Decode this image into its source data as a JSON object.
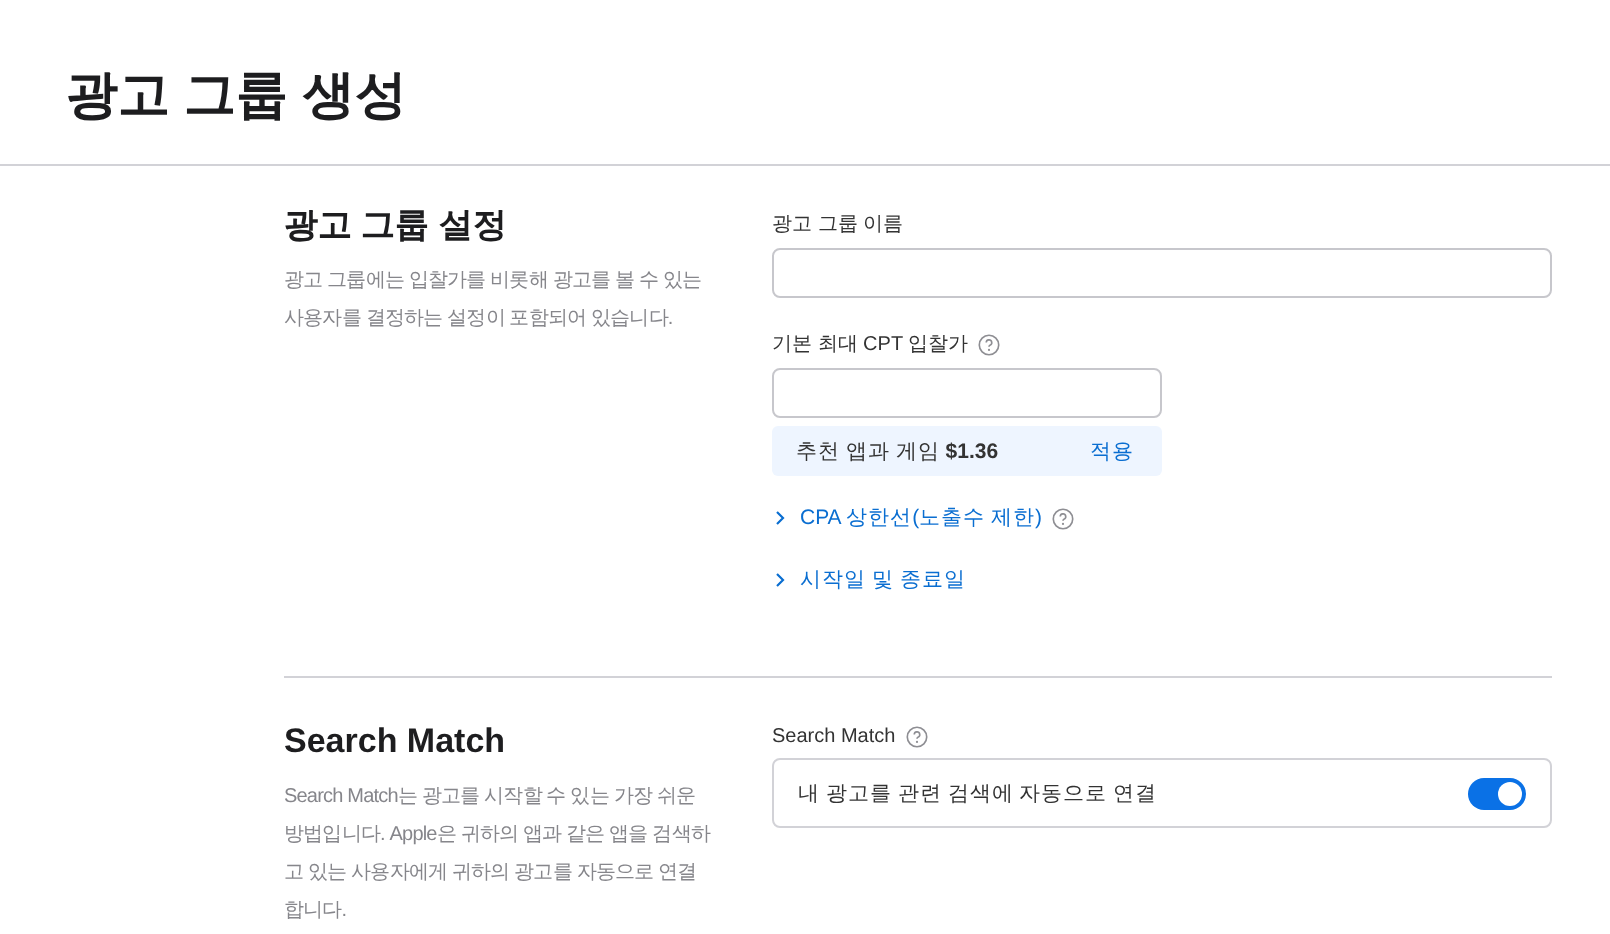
{
  "page_title": "광고 그룹 생성",
  "sections": [
    {
      "heading": "광고 그룹 설정",
      "description": "광고 그룹에는 입찰가를 비롯해 광고를 볼 수 있는 사용자를 결정하는 설정이 포함되어 있습니다.",
      "items": [
        {
          "kind": "wide_input",
          "label": "광고 그룹 이름",
          "help": false
        },
        {
          "kind": "narrow_input",
          "label": "기본 최대 CPT 입찰가",
          "help": true
        },
        {
          "kind": "suggestion",
          "text": "추천 앱과 게임 **$1.36**",
          "action": "적용"
        },
        {
          "kind": "disclosure",
          "label": "CPA 상한선(노출수 제한)",
          "help": true,
          "expanded": false
        },
        {
          "kind": "disclosure",
          "label": "시작일 및 종료일",
          "help": false,
          "expanded": false
        }
      ]
    },
    {
      "heading": "Search Match",
      "description": "Search Match는 광고를 시작할 수 있는 가장 쉬운 방법입니다. Apple은 귀하의 앱과 같은 앱을 검색하고 있는 사용자에게 귀하의 광고를 자동으로 연결합니다.",
      "items": [
        {
          "kind": "toggle",
          "label": "Search Match",
          "help": true,
          "text": "내 광고를 관련 검색에 자동으로 연결",
          "on": true
        }
      ]
    }
  ]
}
